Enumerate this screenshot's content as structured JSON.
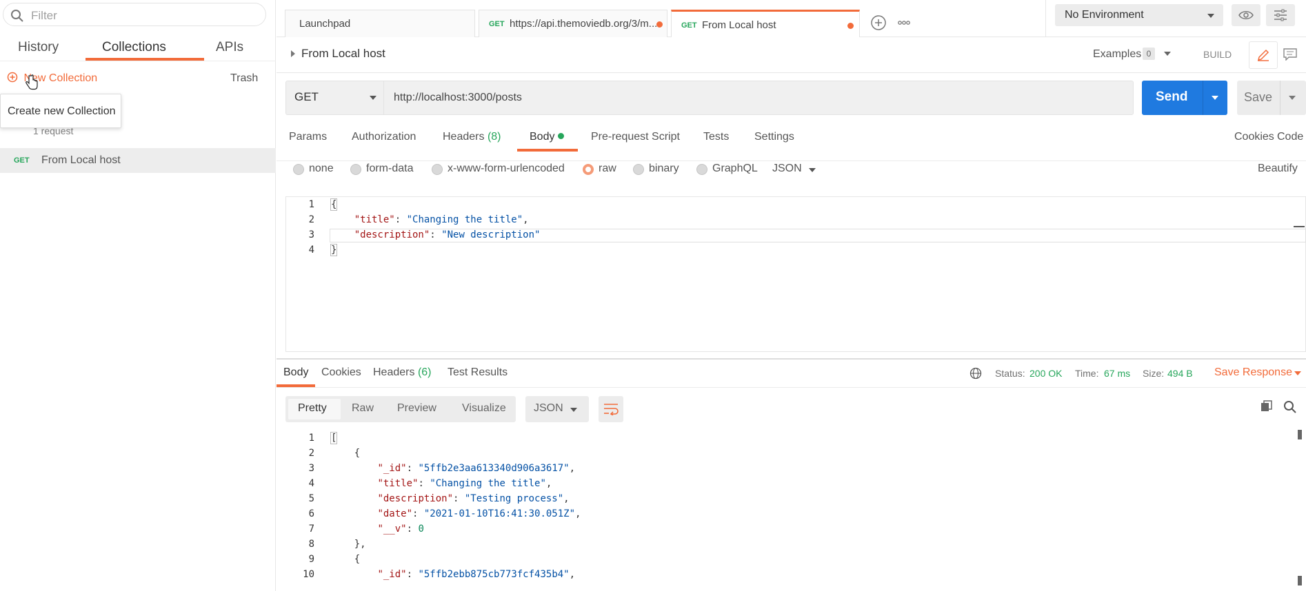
{
  "sidebar": {
    "search_placeholder": "Filter",
    "tabs": [
      "History",
      "Collections",
      "APIs"
    ],
    "active_tab": "Collections",
    "new_collection_label": "New Collection",
    "trash_label": "Trash",
    "tooltip": "Create new Collection",
    "request_count": "1 request",
    "item": {
      "method": "GET",
      "name": "From Local host"
    }
  },
  "tabs": [
    {
      "label": "Launchpad"
    },
    {
      "method": "GET",
      "label": "https://api.themoviedb.org/3/m..."
    },
    {
      "method": "GET",
      "label": "From Local host"
    }
  ],
  "environment": {
    "selected": "No Environment"
  },
  "request": {
    "title": "From Local host",
    "examples_label": "Examples",
    "examples_count": "0",
    "build_label": "BUILD",
    "method": "GET",
    "url": "http://localhost:3000/posts",
    "send_label": "Send",
    "save_label": "Save",
    "tabs": [
      "Params",
      "Authorization",
      "Headers",
      "Body",
      "Pre-request Script",
      "Tests",
      "Settings"
    ],
    "headers_count": "(8)",
    "cookies_label": "Cookies",
    "code_label": "Code",
    "body_modes": [
      "none",
      "form-data",
      "x-www-form-urlencoded",
      "raw",
      "binary",
      "GraphQL"
    ],
    "selected_mode": "raw",
    "format": "JSON",
    "beautify_label": "Beautify",
    "body_lines": [
      "{",
      "    \"title\": \"Changing the title\",",
      "    \"description\": \"New description\"",
      "}"
    ]
  },
  "response": {
    "tabs": [
      "Body",
      "Cookies",
      "Headers",
      "Test Results"
    ],
    "headers_count": "(6)",
    "status_label": "Status:",
    "status_value": "200 OK",
    "time_label": "Time:",
    "time_value": "67 ms",
    "size_label": "Size:",
    "size_value": "494 B",
    "save_response_label": "Save Response",
    "view_modes": [
      "Pretty",
      "Raw",
      "Preview",
      "Visualize"
    ],
    "format": "JSON",
    "body_lines": [
      "[",
      "    {",
      "        \"_id\": \"5ffb2e3aa613340d906a3617\",",
      "        \"title\": \"Changing the title\",",
      "        \"description\": \"Testing process\",",
      "        \"date\": \"2021-01-10T16:41:30.051Z\",",
      "        \"__v\": 0",
      "    },",
      "    {",
      "        \"_id\": \"5ffb2ebb875cb773fcf435b4\","
    ]
  },
  "colors": {
    "accent": "#f26b3a",
    "send": "#1f7ae0",
    "get": "#26a65b"
  }
}
